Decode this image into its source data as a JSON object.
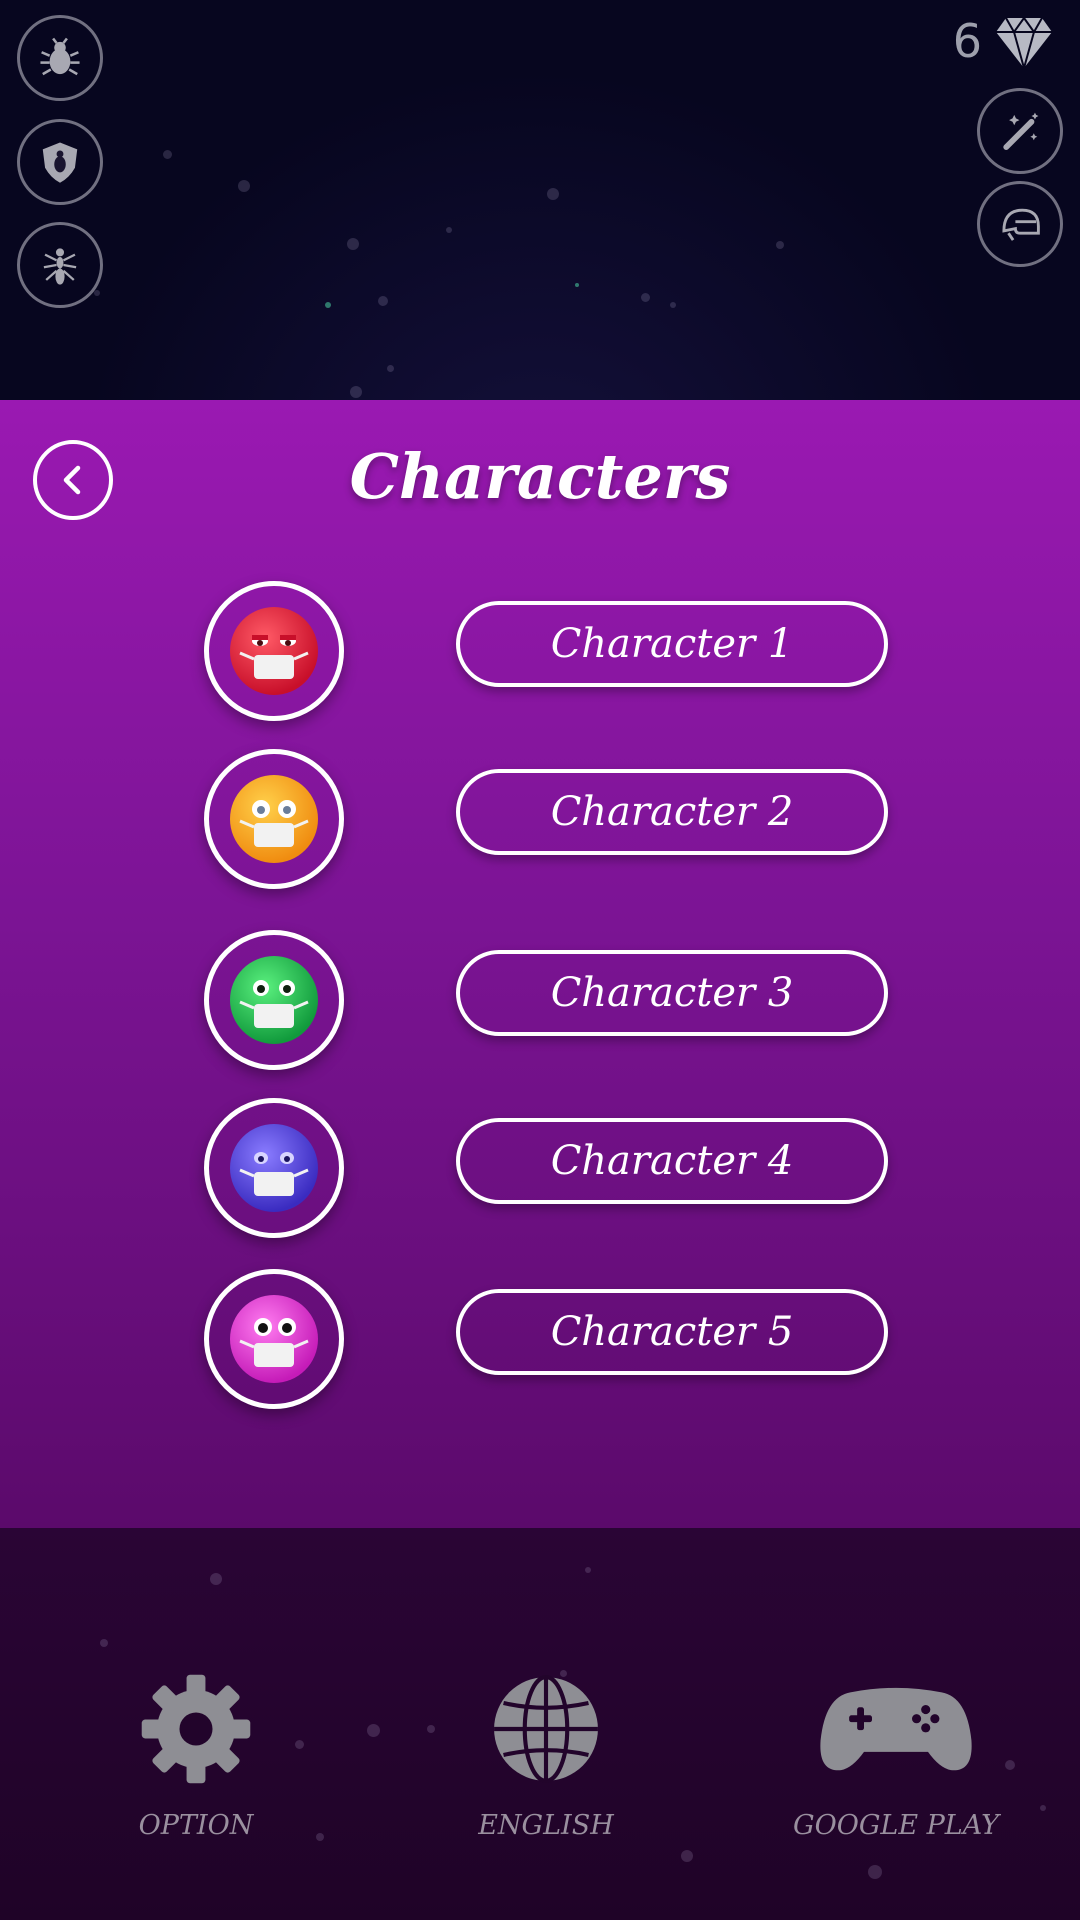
{
  "hud": {
    "gem_count": "6",
    "left_buttons": [
      "bug-icon",
      "shield-bug-icon",
      "ant-icon"
    ],
    "right_buttons": [
      "magic-wand-icon",
      "helmet-icon"
    ],
    "gem_icon": "diamond-icon"
  },
  "panel": {
    "title": "Characters",
    "back_icon": "chevron-left-icon",
    "characters": [
      {
        "label": "Character 1",
        "color": "#e8213a"
      },
      {
        "label": "Character 2",
        "color": "#f5a623"
      },
      {
        "label": "Character 3",
        "color": "#22c552"
      },
      {
        "label": "Character 4",
        "color": "#5b4de0"
      },
      {
        "label": "Character 5",
        "color": "#e83ed6"
      }
    ]
  },
  "bottom_nav": {
    "option": {
      "label": "OPTION",
      "icon": "gear-icon"
    },
    "language": {
      "label": "ENGLISH",
      "icon": "globe-icon"
    },
    "google_play": {
      "label": "GOOGLE PLAY",
      "icon": "gamepad-icon"
    }
  },
  "colors": {
    "panel_top": "#9a19b2",
    "panel_bottom": "#5b0a6b",
    "background": "#07061f"
  }
}
